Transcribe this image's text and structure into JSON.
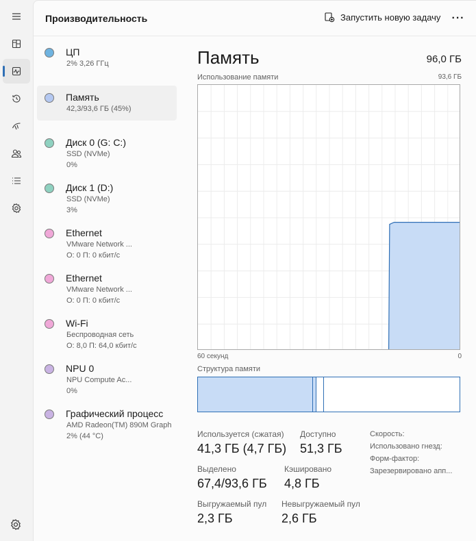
{
  "header": {
    "title": "Производительность",
    "run_task_label": "Запустить новую задачу",
    "more_label": "···"
  },
  "devices": [
    {
      "name": "ЦП",
      "sub1": "2% 3,26 ГГц",
      "sub2": "",
      "color": "#6fb3e0"
    },
    {
      "name": "Память",
      "sub1": "42,3/93,6 ГБ (45%)",
      "sub2": "",
      "color": "#b4c8f1"
    },
    {
      "name": "Диск 0 (G: C:)",
      "sub1": "SSD (NVMe)",
      "sub2": "0%",
      "color": "#8fd1c0"
    },
    {
      "name": "Диск 1 (D:)",
      "sub1": "SSD (NVMe)",
      "sub2": "3%",
      "color": "#8fd1c0"
    },
    {
      "name": "Ethernet",
      "sub1": "VMware Network ...",
      "sub2": "О: 0 П: 0 кбит/с",
      "color": "#f0a8d8"
    },
    {
      "name": "Ethernet",
      "sub1": "VMware Network ...",
      "sub2": "О: 0 П: 0 кбит/с",
      "color": "#f0a8d8"
    },
    {
      "name": "Wi-Fi",
      "sub1": "Беспроводная сеть",
      "sub2": "О: 8,0 П: 64,0 кбит/с",
      "color": "#f0a8d8"
    },
    {
      "name": "NPU 0",
      "sub1": "NPU Compute Ac...",
      "sub2": "0%",
      "color": "#c9b3e3"
    },
    {
      "name": "Графический процесс",
      "sub1": "AMD Radeon(TM) 890M Graph",
      "sub2": "2% (44 °C)",
      "color": "#c9b3e3"
    }
  ],
  "memory": {
    "title": "Память",
    "total": "96,0 ГБ",
    "usage_label": "Использование памяти",
    "usage_max": "93,6 ГБ",
    "axis_left": "60 секунд",
    "axis_right": "0",
    "structure_label": "Структура памяти",
    "usage_series": [
      0,
      0,
      0,
      0,
      0,
      0,
      0,
      0,
      0,
      0,
      0,
      0,
      0,
      0,
      0,
      0,
      0,
      0,
      0,
      0,
      0,
      0,
      0,
      0,
      0,
      0,
      0,
      0,
      0,
      0,
      0,
      0,
      0,
      0,
      0,
      0,
      0,
      0,
      0,
      0,
      0,
      0,
      0,
      44.5,
      45.2,
      45.2,
      45.2,
      45.2,
      45.2,
      45.2,
      45.2,
      45.2,
      45.2,
      45.2,
      45.2,
      45.2,
      45.2,
      45.2,
      45.2,
      45.2
    ],
    "structure": {
      "in_use_fraction": 0.44,
      "modified_fraction": 0.012,
      "standby_fraction": 0.03
    },
    "stats": {
      "in_use_label": "Используется (сжатая)",
      "in_use_value": "41,3 ГБ (4,7 ГБ)",
      "available_label": "Доступно",
      "available_value": "51,3 ГБ",
      "committed_label": "Выделено",
      "committed_value": "67,4/93,6 ГБ",
      "cached_label": "Кэшировано",
      "cached_value": "4,8 ГБ",
      "paged_label": "Выгружаемый пул",
      "paged_value": "2,3 ГБ",
      "nonpaged_label": "Невыгружаемый пул",
      "nonpaged_value": "2,6 ГБ",
      "speed_label": "Скорость:",
      "slots_label": "Использовано гнезд:",
      "form_label": "Форм-фактор:",
      "reserved_label": "Зарезервировано апп..."
    }
  },
  "colors": {
    "accent": "#2f6fb5",
    "graph_fill": "#c8dcf6",
    "graph_line": "#2f6fb5"
  }
}
